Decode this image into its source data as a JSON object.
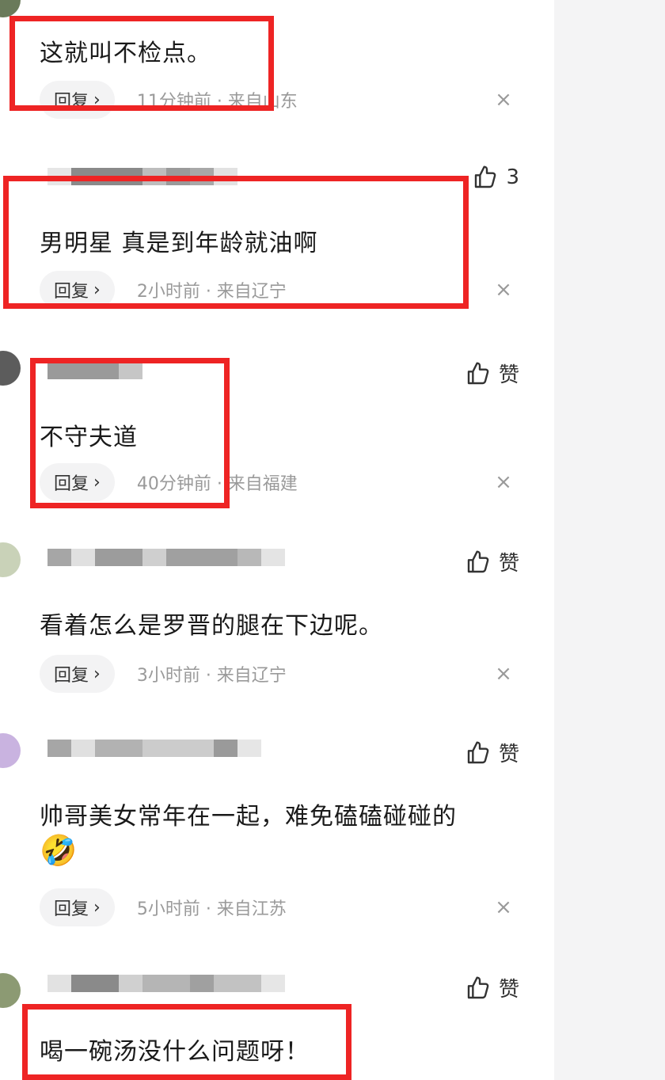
{
  "common": {
    "reply_label": "回复",
    "reply_chevron": "›",
    "close_glyph": "×",
    "like_icon": "thumbs-up-icon"
  },
  "comments": [
    {
      "text": "这就叫不检点。",
      "meta": "11分钟前 · 来自山东",
      "like": ""
    },
    {
      "text": "男明星 真是到年龄就油啊",
      "meta": "2小时前 · 来自辽宁",
      "like": "3"
    },
    {
      "text": "不守夫道",
      "meta": "40分钟前 · 来自福建",
      "like": "赞"
    },
    {
      "text": "看着怎么是罗晋的腿在下边呢。",
      "meta": "3小时前 · 来自辽宁",
      "like": "赞"
    },
    {
      "text": "帅哥美女常年在一起，难免磕磕碰碰的",
      "emoji": "🤣",
      "meta": "5小时前 · 来自江苏",
      "like": "赞"
    },
    {
      "text": "喝一碗汤没什么问题呀！",
      "meta": "",
      "like": "赞"
    }
  ],
  "colors": {
    "highlight": "#ee2424",
    "background": "#ffffff",
    "side_panel": "#f4f4f5",
    "meta_text": "#9a9a9a"
  }
}
